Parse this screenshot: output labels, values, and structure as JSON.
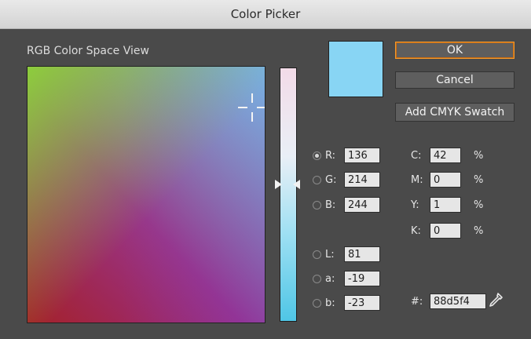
{
  "window": {
    "title": "Color Picker"
  },
  "view_label": "RGB Color Space View",
  "selected_color": "#88d5f4",
  "buttons": {
    "ok": "OK",
    "cancel": "Cancel",
    "add_swatch": "Add CMYK Swatch"
  },
  "rgb": [
    {
      "label": "R:",
      "value": "136",
      "checked": true
    },
    {
      "label": "G:",
      "value": "214",
      "checked": false
    },
    {
      "label": "B:",
      "value": "244",
      "checked": false
    }
  ],
  "lab": [
    {
      "label": "L:",
      "value": "81"
    },
    {
      "label": "a:",
      "value": "-19"
    },
    {
      "label": "b:",
      "value": "-23"
    }
  ],
  "cmyk": [
    {
      "label": "C:",
      "value": "42",
      "unit": "%"
    },
    {
      "label": "M:",
      "value": "0",
      "unit": "%"
    },
    {
      "label": "Y:",
      "value": "1",
      "unit": "%"
    },
    {
      "label": "K:",
      "value": "0",
      "unit": "%"
    }
  ],
  "hex": {
    "label": "#:",
    "value": "88d5f4"
  },
  "icons": {
    "eyedropper": "eyedropper-icon",
    "crosshair": "crosshair-icon"
  }
}
